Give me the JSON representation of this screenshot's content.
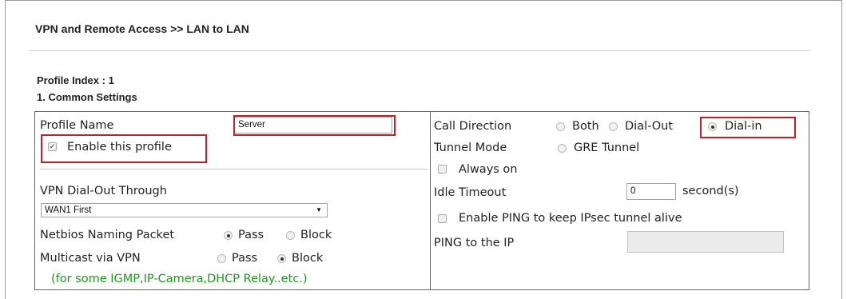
{
  "breadcrumb": "VPN and Remote Access >> LAN to LAN",
  "profile_index": "Profile Index : 1",
  "section_title": "1. Common Settings",
  "left": {
    "profile_name_label": "Profile Name",
    "profile_name_value": "Server",
    "enable_profile_label": "Enable this profile",
    "enable_profile_checked": true,
    "dialout_through_label": "VPN Dial-Out Through",
    "dialout_through_value": "WAN1 First",
    "netbios_label": "Netbios Naming Packet",
    "netbios_options": [
      "Pass",
      "Block"
    ],
    "netbios_selected": "Pass",
    "multicast_label": "Multicast via VPN",
    "multicast_options": [
      "Pass",
      "Block"
    ],
    "multicast_selected": "Block",
    "multicast_note": "(for some IGMP,IP-Camera,DHCP Relay..etc.)"
  },
  "right": {
    "call_direction_label": "Call Direction",
    "call_direction_options": [
      "Both",
      "Dial-Out",
      "Dial-in"
    ],
    "call_direction_selected": "Dial-in",
    "tunnel_mode_label": "Tunnel Mode",
    "tunnel_mode_option": "GRE Tunnel",
    "always_on_label": "Always on",
    "idle_timeout_label": "Idle Timeout",
    "idle_timeout_value": "0",
    "idle_timeout_unit": "second(s)",
    "enable_ping_label": "Enable PING to keep IPsec tunnel alive",
    "ping_ip_label": "PING to the IP",
    "ping_ip_value": ""
  },
  "colors": {
    "highlight": "#c0202a",
    "note": "#1c9a1c"
  }
}
